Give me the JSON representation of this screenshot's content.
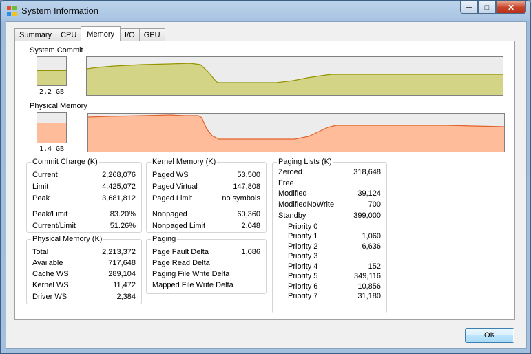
{
  "window": {
    "title": "System Information",
    "caption_buttons": {
      "minimize": "─",
      "maximize": "□",
      "close": "✕"
    }
  },
  "tabs": [
    "Summary",
    "CPU",
    "Memory",
    "I/O",
    "GPU"
  ],
  "active_tab": "Memory",
  "system_commit": {
    "label": "System Commit",
    "gauge_value": "2.2 GB",
    "gauge_fill_fraction": 0.51,
    "color_fill": "#d4d486",
    "color_line": "#949400"
  },
  "physical_memory_graph": {
    "label": "Physical Memory",
    "gauge_value": "1.4 GB",
    "gauge_fill_fraction": 0.65,
    "color_fill": "#ffbc9a",
    "color_line": "#e2622b"
  },
  "commit_charge": {
    "title": "Commit Charge (K)",
    "rows": [
      {
        "label": "Current",
        "value": "2,268,076"
      },
      {
        "label": "Limit",
        "value": "4,425,072"
      },
      {
        "label": "Peak",
        "value": "3,681,812"
      }
    ],
    "rows2": [
      {
        "label": "Peak/Limit",
        "value": "83.20%"
      },
      {
        "label": "Current/Limit",
        "value": "51.26%"
      }
    ]
  },
  "physical_memory": {
    "title": "Physical Memory (K)",
    "rows": [
      {
        "label": "Total",
        "value": "2,213,372"
      },
      {
        "label": "Available",
        "value": "717,648"
      },
      {
        "label": "Cache WS",
        "value": "289,104"
      },
      {
        "label": "Kernel WS",
        "value": "11,472"
      },
      {
        "label": "Driver WS",
        "value": "2,384"
      }
    ]
  },
  "kernel_memory": {
    "title": "Kernel Memory (K)",
    "rows": [
      {
        "label": "Paged WS",
        "value": "53,500"
      },
      {
        "label": "Paged Virtual",
        "value": "147,808"
      },
      {
        "label": "Paged Limit",
        "value": "no symbols"
      }
    ],
    "rows2": [
      {
        "label": "Nonpaged",
        "value": "60,360"
      },
      {
        "label": "Nonpaged Limit",
        "value": "2,048"
      }
    ]
  },
  "paging": {
    "title": "Paging",
    "rows": [
      {
        "label": "Page Fault Delta",
        "value": "1,086"
      },
      {
        "label": "Page Read Delta",
        "value": ""
      },
      {
        "label": "Paging File Write Delta",
        "value": ""
      },
      {
        "label": "Mapped File Write Delta",
        "value": ""
      }
    ]
  },
  "paging_lists": {
    "title": "Paging Lists (K)",
    "rows": [
      {
        "label": "Zeroed",
        "value": "318,648"
      },
      {
        "label": "Free",
        "value": ""
      },
      {
        "label": "Modified",
        "value": "39,124"
      },
      {
        "label": "ModifiedNoWrite",
        "value": "700"
      },
      {
        "label": "Standby",
        "value": "399,000"
      }
    ],
    "priorities": [
      {
        "label": "Priority 0",
        "value": ""
      },
      {
        "label": "Priority 1",
        "value": "1,060"
      },
      {
        "label": "Priority 2",
        "value": "6,636"
      },
      {
        "label": "Priority 3",
        "value": ""
      },
      {
        "label": "Priority 4",
        "value": "152"
      },
      {
        "label": "Priority 5",
        "value": "349,116"
      },
      {
        "label": "Priority 6",
        "value": "10,856"
      },
      {
        "label": "Priority 7",
        "value": "31,180"
      }
    ]
  },
  "ok_button": "OK"
}
